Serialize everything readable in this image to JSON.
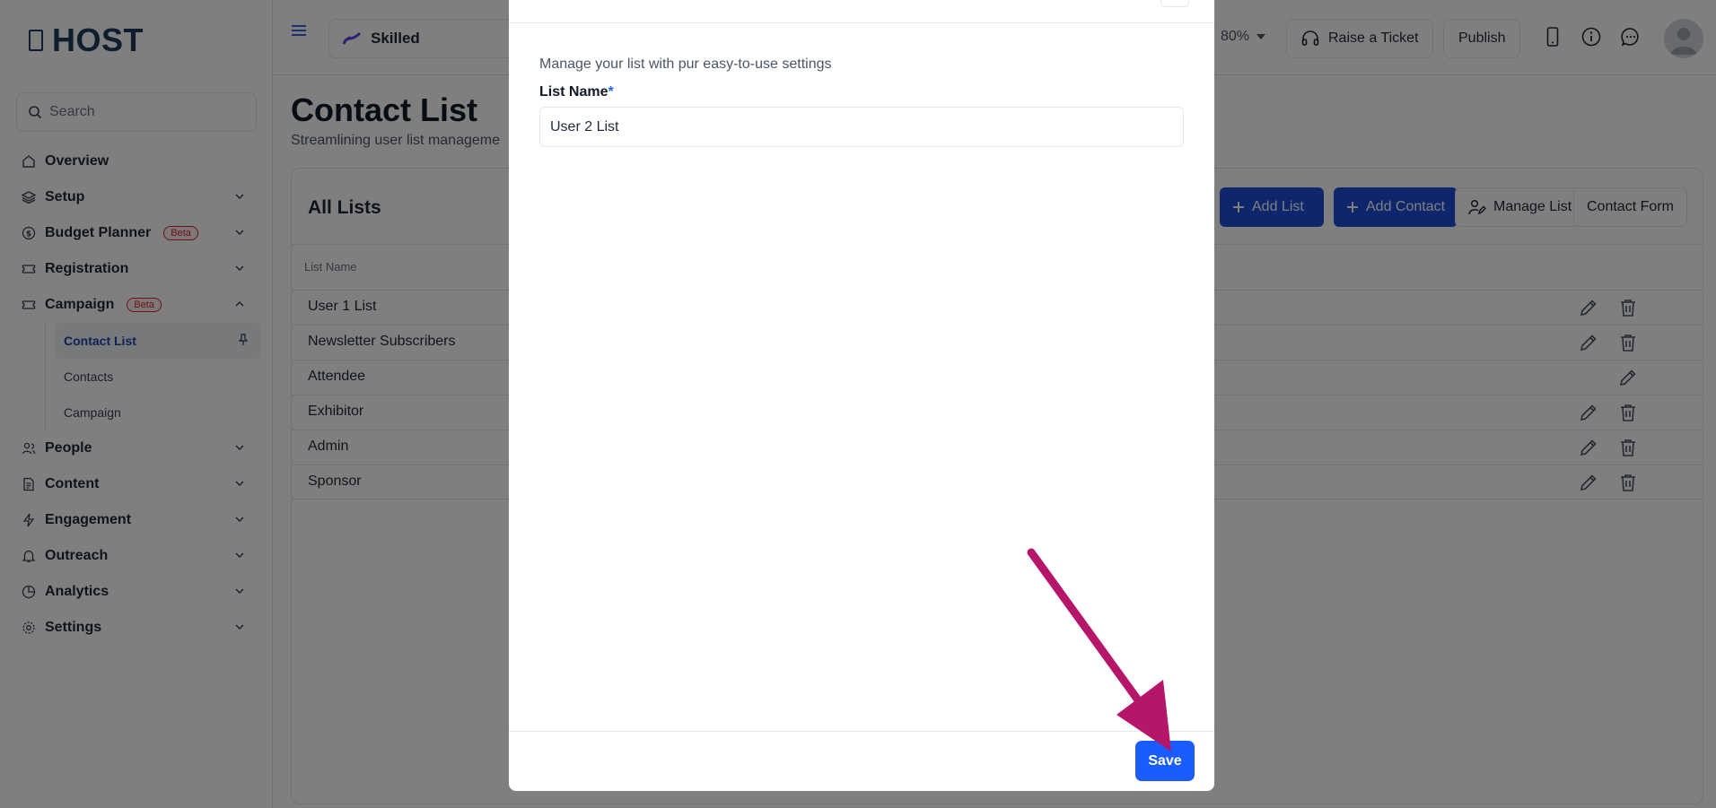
{
  "app": {
    "logo": "HOST"
  },
  "sidebar": {
    "search_placeholder": "Search",
    "items": [
      {
        "label": "Overview"
      },
      {
        "label": "Setup"
      },
      {
        "label": "Budget Planner",
        "badge": "Beta"
      },
      {
        "label": "Registration"
      },
      {
        "label": "Campaign",
        "badge": "Beta"
      },
      {
        "label": "People"
      },
      {
        "label": "Content"
      },
      {
        "label": "Engagement"
      },
      {
        "label": "Outreach"
      },
      {
        "label": "Analytics"
      },
      {
        "label": "Settings"
      }
    ],
    "campaign_sub": [
      {
        "label": "Contact List"
      },
      {
        "label": "Contacts"
      },
      {
        "label": "Campaign"
      }
    ]
  },
  "header": {
    "event_name": "Skilled",
    "zoom": "80%",
    "raise_ticket": "Raise a Ticket",
    "publish": "Publish"
  },
  "main": {
    "title": "Contact List",
    "subtitle": "Streamlining user list manageme",
    "card_title": "All Lists",
    "buttons": {
      "add_list": "Add List",
      "add_contact": "Add Contact",
      "manage_list": "Manage List",
      "contact_form": "Contact Form"
    },
    "table": {
      "column": "List Name",
      "rows": [
        {
          "name": "User 1 List"
        },
        {
          "name": "Newsletter Subscribers"
        },
        {
          "name": "Attendee"
        },
        {
          "name": "Exhibitor"
        },
        {
          "name": "Admin"
        },
        {
          "name": "Sponsor"
        }
      ]
    }
  },
  "modal": {
    "description": "Manage your list with pur easy-to-use settings",
    "field_label": "List Name",
    "required_mark": "*",
    "field_value": "User 2 List",
    "save": "Save"
  },
  "colors": {
    "primary": "#1d4ed8",
    "save": "#1a5cff",
    "brand": "#1e3a5f",
    "arrow": "#b5166a",
    "beta": "#dc2626"
  }
}
